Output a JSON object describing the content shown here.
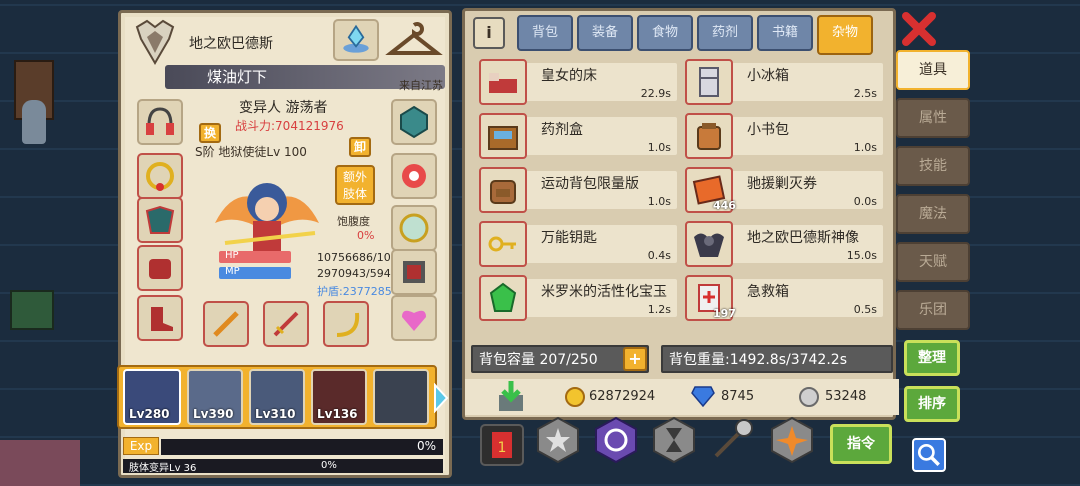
{
  "character": {
    "title": "地之欧巴德斯",
    "name": "煤油灯下",
    "origin": "来自江苏",
    "class_text": "变异人 游荡者",
    "power": "战斗力:704121976",
    "skill_text": "S阶 地狱使徒Lv 100",
    "swap_label": "换",
    "unequip_label": "卸",
    "extra_limb_label": "额外\n肢体",
    "hunger_label": "饱腹度",
    "hunger_value": "0%",
    "hp_label": "HP",
    "mp_label": "MP",
    "hp_value": "10756686/10",
    "mp_value": "2970943/594",
    "shield_value": "护盾:2377285"
  },
  "party": [
    {
      "level": "Lv280"
    },
    {
      "level": "Lv390"
    },
    {
      "level": "Lv310"
    },
    {
      "level": "Lv136"
    },
    {
      "level": ""
    }
  ],
  "exp": {
    "label": "Exp",
    "percent": "0%",
    "progress": 0
  },
  "limb": {
    "label": "肢体变异Lv 36",
    "percent": "0%",
    "progress": 0
  },
  "tabs": [
    {
      "label": "背包"
    },
    {
      "label": "装备"
    },
    {
      "label": "食物"
    },
    {
      "label": "药剂"
    },
    {
      "label": "书籍"
    },
    {
      "label": "杂物"
    }
  ],
  "active_tab": "杂物",
  "items": [
    {
      "name": "皇女的床",
      "time": "22.9s",
      "icon": "bed-icon",
      "badge": ""
    },
    {
      "name": "小冰箱",
      "time": "2.5s",
      "icon": "fridge-icon",
      "badge": ""
    },
    {
      "name": "药剂盒",
      "time": "1.0s",
      "icon": "potion-box-icon",
      "badge": ""
    },
    {
      "name": "小书包",
      "time": "1.0s",
      "icon": "schoolbag-icon",
      "badge": ""
    },
    {
      "name": "运动背包限量版",
      "time": "1.0s",
      "icon": "backpack-icon",
      "badge": ""
    },
    {
      "name": "驰援剿灭券",
      "time": "0.0s",
      "icon": "ticket-icon",
      "badge": "446"
    },
    {
      "name": "万能钥匙",
      "time": "0.4s",
      "icon": "key-icon",
      "badge": ""
    },
    {
      "name": "地之欧巴德斯神像",
      "time": "15.0s",
      "icon": "statue-icon",
      "badge": ""
    },
    {
      "name": "米罗米的活性化宝玉",
      "time": "1.2s",
      "icon": "gem-icon",
      "badge": ""
    },
    {
      "name": "急救箱",
      "time": "0.5s",
      "icon": "first-aid-icon",
      "badge": "197"
    }
  ],
  "capacity": {
    "label": "背包容量 207/250",
    "plus": "+"
  },
  "weight": "背包重量:1492.8s/3742.2s",
  "currency": {
    "gold": "62872924",
    "diamond": "8745",
    "silver": "53248"
  },
  "side_tabs": [
    {
      "label": "道具"
    },
    {
      "label": "属性"
    },
    {
      "label": "技能"
    },
    {
      "label": "魔法"
    },
    {
      "label": "天赋"
    },
    {
      "label": "乐团"
    }
  ],
  "buttons": {
    "sort_tidy": "整理",
    "sort_order": "排序",
    "command": "指令"
  },
  "colors": {
    "accent": "#f2b22e",
    "red": "#c05048",
    "panel": "#e9dfc5",
    "hp": "#e86a6a",
    "mp": "#4a8ae0",
    "green": "#5ca83c"
  }
}
